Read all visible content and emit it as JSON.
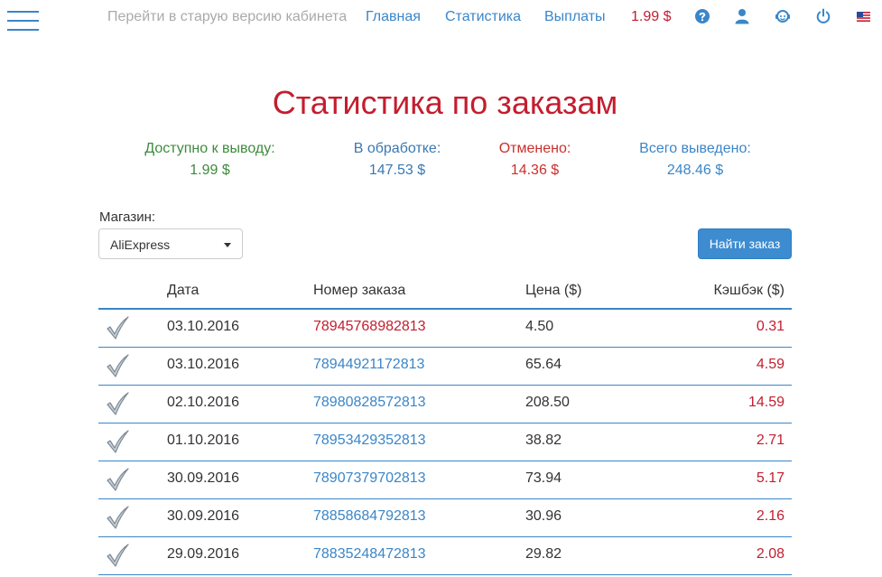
{
  "nav": {
    "old_version": "Перейти в старую версию кабинета",
    "home": "Главная",
    "stats": "Статистика",
    "payouts": "Выплаты",
    "balance": "1.99 $",
    "icons": [
      "help-icon",
      "user-icon",
      "support-icon",
      "power-icon",
      "us-flag-icon"
    ]
  },
  "title": "Статистика по заказам",
  "summary": {
    "available": {
      "label": "Доступно к выводу:",
      "value": "1.99 $"
    },
    "processing": {
      "label": "В обработке:",
      "value": "147.53 $"
    },
    "cancelled": {
      "label": "Отменено:",
      "value": "14.36 $"
    },
    "withdrawn": {
      "label": "Всего выведено:",
      "value": "248.46 $"
    }
  },
  "filter": {
    "store_label": "Магазин:",
    "store_value": "AliExpress",
    "find_button": "Найти заказ"
  },
  "table": {
    "headers": {
      "date": "Дата",
      "order": "Номер заказа",
      "price": "Цена ($)",
      "cashback": "Кэшбэк ($)"
    },
    "rows": [
      {
        "date": "03.10.2016",
        "order": "78945768982813",
        "price": "4.50",
        "cashback": "0.31",
        "order_color": "#c41d2f"
      },
      {
        "date": "03.10.2016",
        "order": "78944921172813",
        "price": "65.64",
        "cashback": "4.59",
        "order_color": "#3a86c8"
      },
      {
        "date": "02.10.2016",
        "order": "78980828572813",
        "price": "208.50",
        "cashback": "14.59",
        "order_color": "#3a86c8"
      },
      {
        "date": "01.10.2016",
        "order": "78953429352813",
        "price": "38.82",
        "cashback": "2.71",
        "order_color": "#3a86c8"
      },
      {
        "date": "30.09.2016",
        "order": "78907379702813",
        "price": "73.94",
        "cashback": "5.17",
        "order_color": "#3a86c8"
      },
      {
        "date": "30.09.2016",
        "order": "78858684792813",
        "price": "30.96",
        "cashback": "2.16",
        "order_color": "#3a86c8"
      },
      {
        "date": "29.09.2016",
        "order": "78835248472813",
        "price": "29.82",
        "cashback": "2.08",
        "order_color": "#3a86c8"
      }
    ]
  },
  "colors": {
    "accent": "#3a86c8",
    "danger": "#c41d2f",
    "success": "#3d8b3d"
  }
}
